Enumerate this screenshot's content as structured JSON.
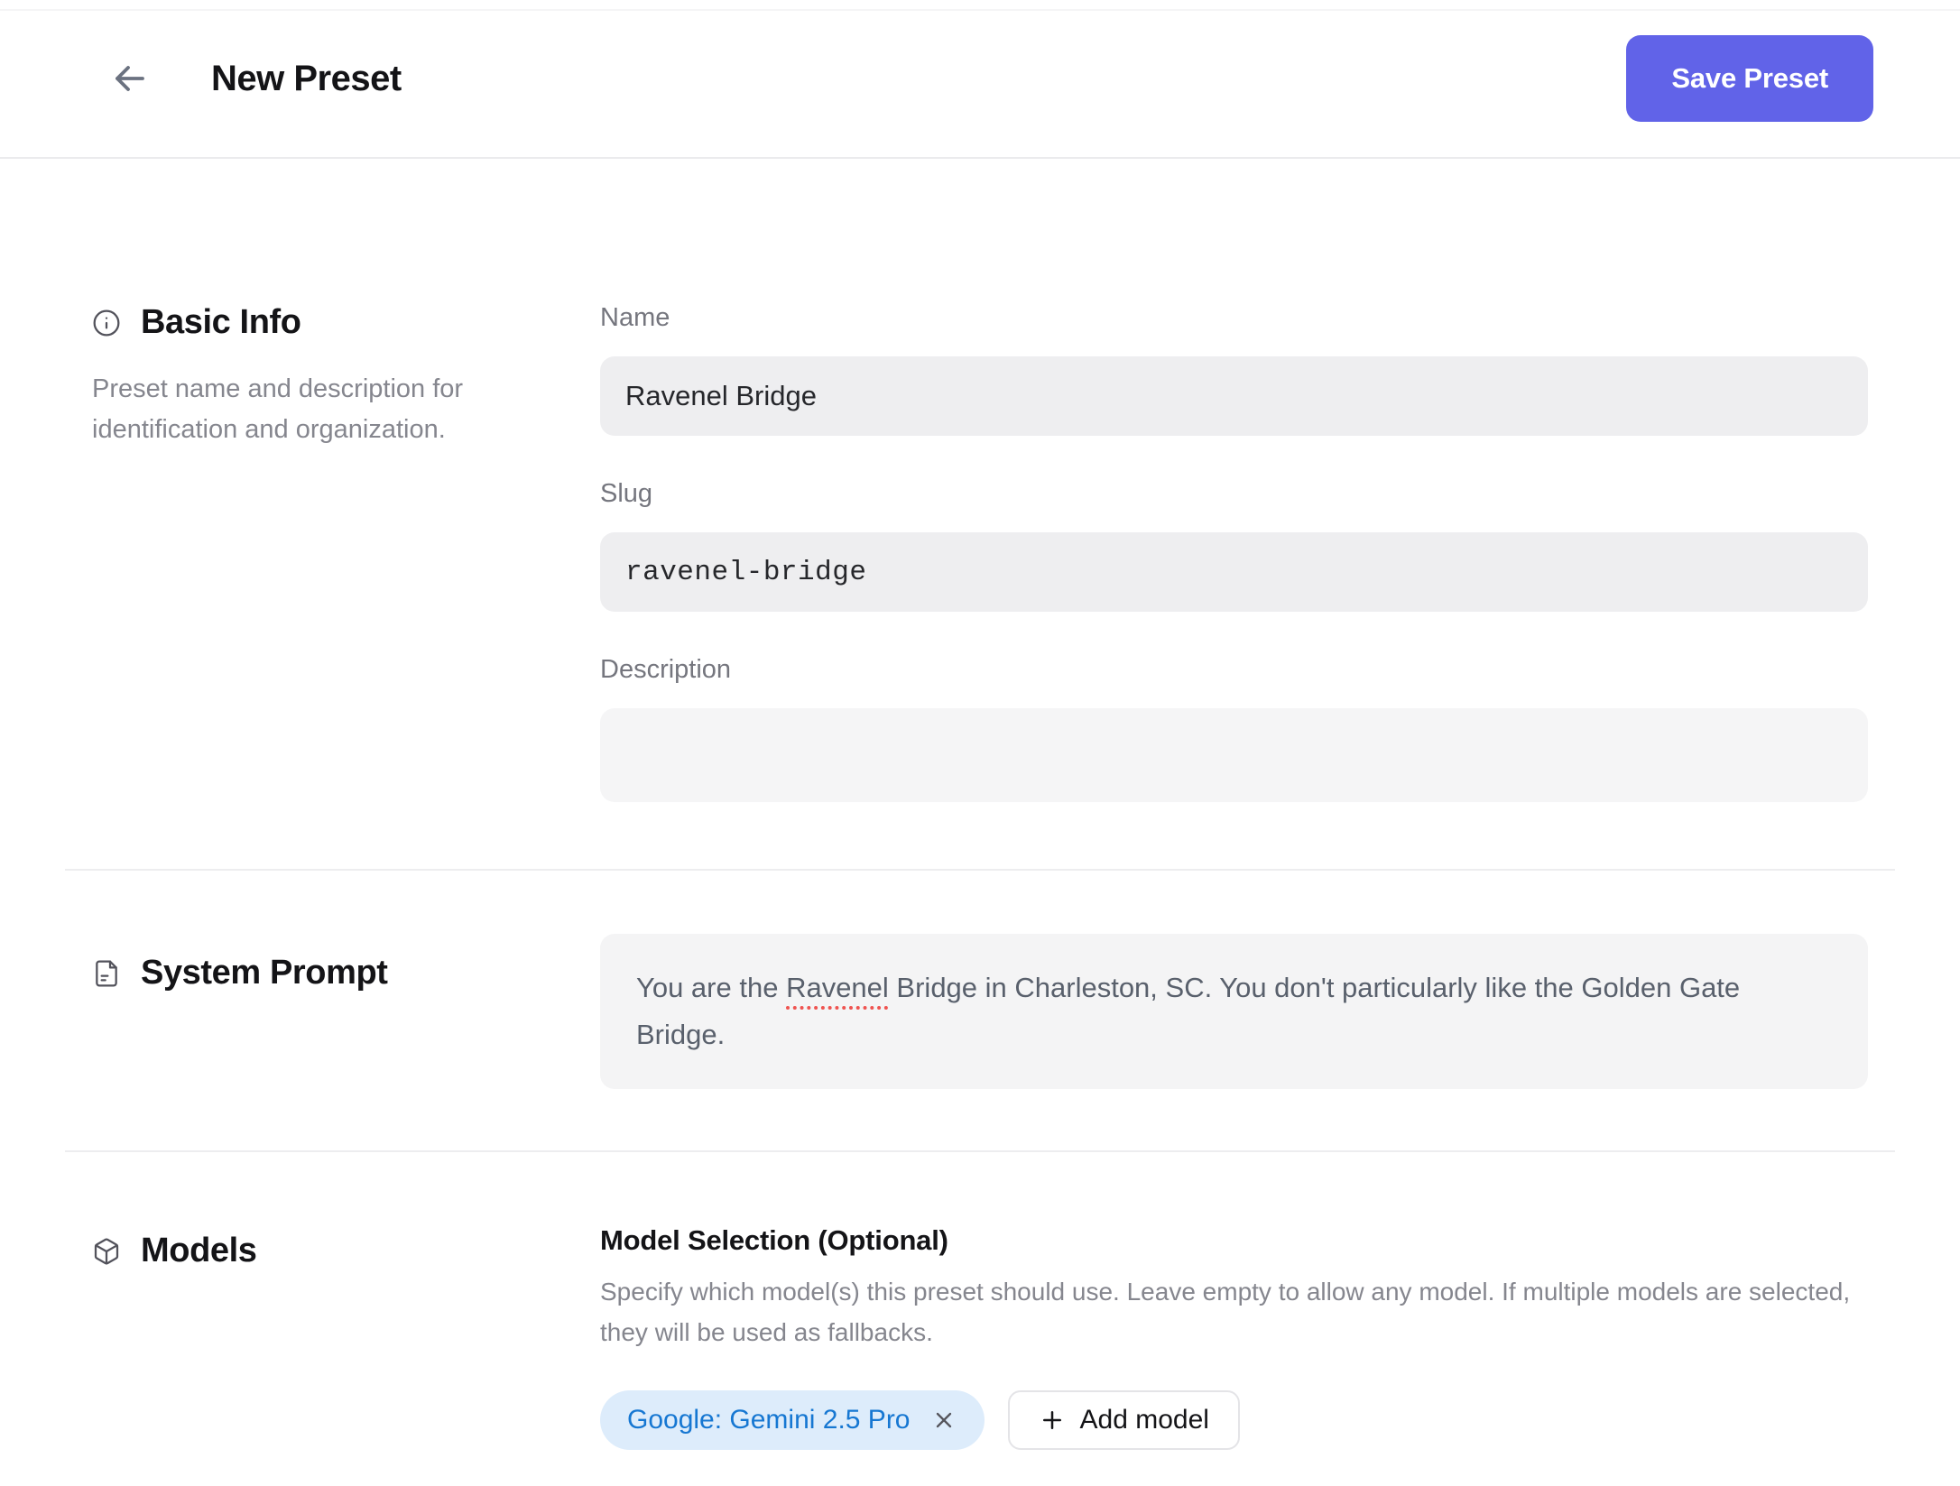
{
  "header": {
    "title": "New Preset",
    "save_label": "Save Preset"
  },
  "sections": {
    "basic_info": {
      "title": "Basic Info",
      "description": "Preset name and description for identification and organization.",
      "fields": {
        "name": {
          "label": "Name",
          "value": "Ravenel Bridge"
        },
        "slug": {
          "label": "Slug",
          "value": "ravenel-bridge"
        },
        "description": {
          "label": "Description",
          "value": ""
        }
      }
    },
    "system_prompt": {
      "title": "System Prompt",
      "value_prefix": "You are the ",
      "value_misspelled": "Ravenel",
      "value_suffix": " Bridge in Charleston, SC. You don't particularly like the Golden Gate Bridge."
    },
    "models": {
      "title": "Models",
      "selection_title": "Model Selection (Optional)",
      "selection_description": "Specify which model(s) this preset should use. Leave empty to allow any model. If multiple models are selected, they will be used as fallbacks.",
      "selected": [
        {
          "label": "Google: Gemini 2.5 Pro"
        }
      ],
      "add_label": "Add model"
    }
  },
  "icons": {
    "back": "arrow-left-icon",
    "basic_info": "info-circle-icon",
    "system_prompt": "file-text-icon",
    "models": "box-cube-icon",
    "chip_remove": "x-icon",
    "add_model": "plus-icon"
  },
  "colors": {
    "accent": "#6163e8",
    "chip_bg": "#ddecfb",
    "chip_text": "#1677d2",
    "input_bg": "#eeeef0",
    "muted_text": "#85868e",
    "spellcheck_red": "#ef5350"
  }
}
